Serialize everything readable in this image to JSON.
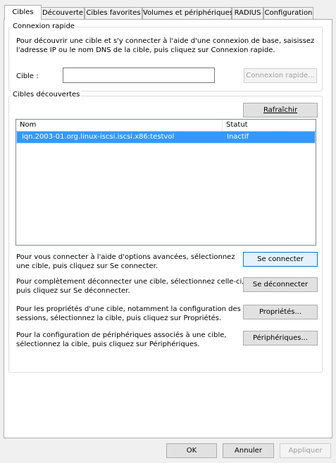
{
  "tabs": [
    {
      "label": "Cibles",
      "active": true
    },
    {
      "label": "Découverte",
      "active": false
    },
    {
      "label": "Cibles favorites",
      "active": false
    },
    {
      "label": "Volumes et périphériques",
      "active": false
    },
    {
      "label": "RADIUS",
      "active": false
    },
    {
      "label": "Configuration",
      "active": false
    }
  ],
  "quick_connect": {
    "title": "Connexion rapide",
    "description_line1": "Pour découvrir une cible et s'y connecter à l'aide d'une connexion de base, saisissez",
    "description_line2": "l'adresse IP ou le nom DNS de la cible, puis cliquez sur Connexion rapide.",
    "target_label": "Cible :",
    "target_value": "",
    "quick_connect_button": "Connexion rapide..."
  },
  "discovered": {
    "title": "Cibles découvertes",
    "refresh_button": "Rafraîchir",
    "columns": [
      "Nom",
      "Statut"
    ],
    "rows": [
      {
        "name": "iqn.2003-01.org.linux-iscsi.iscsi.x86:testvol",
        "status": "Inactif",
        "selected": true
      }
    ]
  },
  "actions": [
    {
      "line1": "Pour vous connecter à l'aide d'options avancées, sélectionnez",
      "line2": "une cible, puis cliquez sur Se connecter.",
      "button": "Se connecter"
    },
    {
      "line1": "Pour complètement déconnecter une cible, sélectionnez celle-ci,",
      "line2": "puis cliquez sur Se déconnecter.",
      "button": "Se déconnecter"
    },
    {
      "line1": "Pour les propriétés d'une cible, notamment la configuration des",
      "line2": "sessions, sélectionnez la cible, puis cliquez sur Propriétés.",
      "button": "Propriétés..."
    },
    {
      "line1": "Pour la configuration de périphériques associés à une cible,",
      "line2": "sélectionnez la cible, puis cliquez sur Périphériques.",
      "button": "Périphériques..."
    }
  ],
  "footer": {
    "ok": "OK",
    "cancel": "Annuler",
    "apply": "Appliquer"
  }
}
